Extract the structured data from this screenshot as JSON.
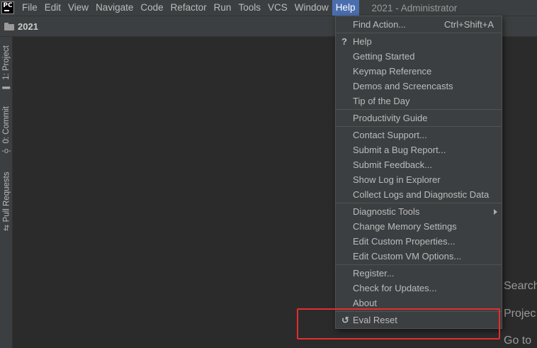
{
  "app": {
    "logo_text": "PC",
    "window_title": "2021 - Administrator"
  },
  "menubar": {
    "items": [
      "File",
      "Edit",
      "View",
      "Navigate",
      "Code",
      "Refactor",
      "Run",
      "Tools",
      "VCS",
      "Window",
      "Help"
    ],
    "active": "Help"
  },
  "navbar": {
    "project": "2021"
  },
  "toolstrip": {
    "tabs": [
      {
        "label": "1: Project",
        "icon": "folder-icon"
      },
      {
        "label": "0: Commit",
        "icon": "commit-icon"
      },
      {
        "label": "Pull Requests",
        "icon": "pull-request-icon"
      }
    ]
  },
  "editor_hints": [
    "Search",
    "Projec",
    "Go to"
  ],
  "help_menu": {
    "find_action": {
      "label": "Find Action...",
      "shortcut": "Ctrl+Shift+A"
    },
    "help": {
      "prefix": "?",
      "label": "Help"
    },
    "getting_started": "Getting Started",
    "keymap_reference": "Keymap Reference",
    "demos": "Demos and Screencasts",
    "tip_of_day": "Tip of the Day",
    "productivity_guide": "Productivity Guide",
    "contact_support": "Contact Support...",
    "submit_bug": "Submit a Bug Report...",
    "submit_feedback": "Submit Feedback...",
    "show_log": "Show Log in Explorer",
    "collect_logs": "Collect Logs and Diagnostic Data",
    "diagnostic_tools": "Diagnostic Tools",
    "change_memory": "Change Memory Settings",
    "edit_properties": "Edit Custom Properties...",
    "edit_vm_options": "Edit Custom VM Options...",
    "register": "Register...",
    "check_updates": "Check for Updates...",
    "about": "About",
    "eval_reset": {
      "prefix": "↺",
      "label": "Eval Reset"
    }
  },
  "colors": {
    "menu_bg": "#3c3f41",
    "editor_bg": "#2b2b2b",
    "active_menu": "#4b6eaf",
    "highlight": "#e52d2d"
  }
}
